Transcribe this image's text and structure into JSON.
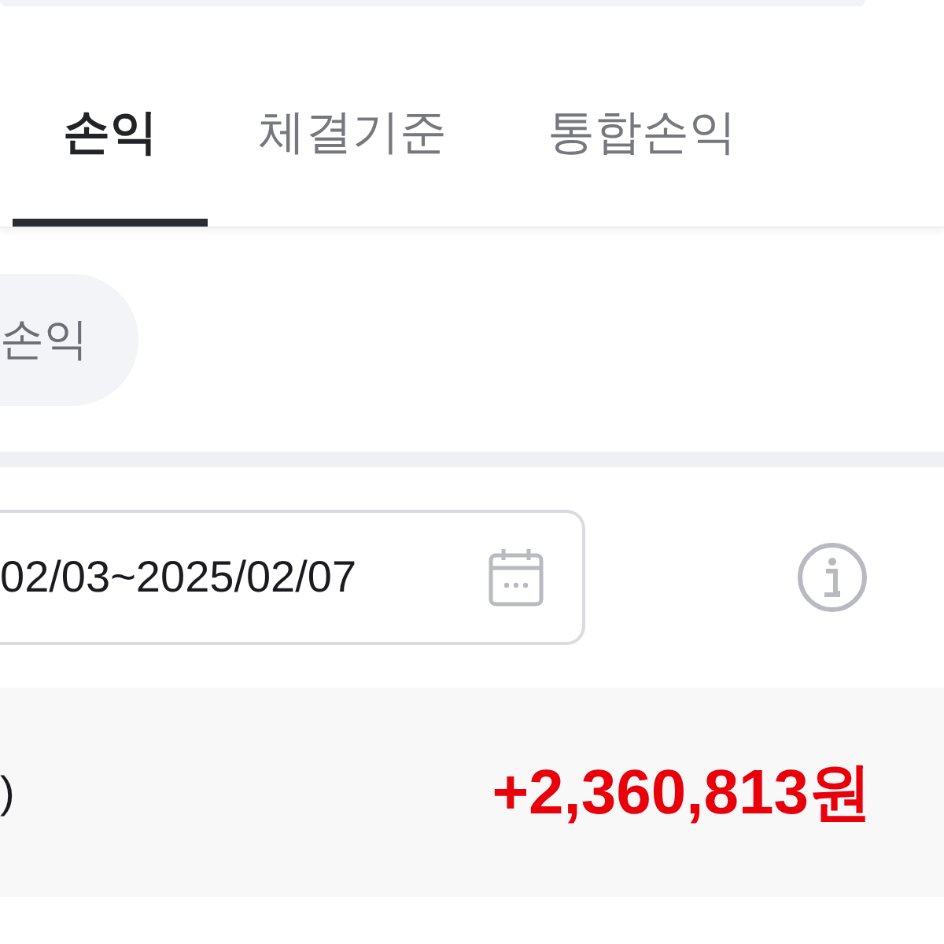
{
  "tabs": [
    {
      "label": "손익",
      "selected": true
    },
    {
      "label": "체결기준",
      "selected": false
    },
    {
      "label": "통합손익",
      "selected": false
    }
  ],
  "filter_chip": {
    "label": "손익"
  },
  "date_range": {
    "value": "02/03~2025/02/07"
  },
  "summary": {
    "label": ")",
    "amount": "+2,360,813원",
    "positive": true
  }
}
